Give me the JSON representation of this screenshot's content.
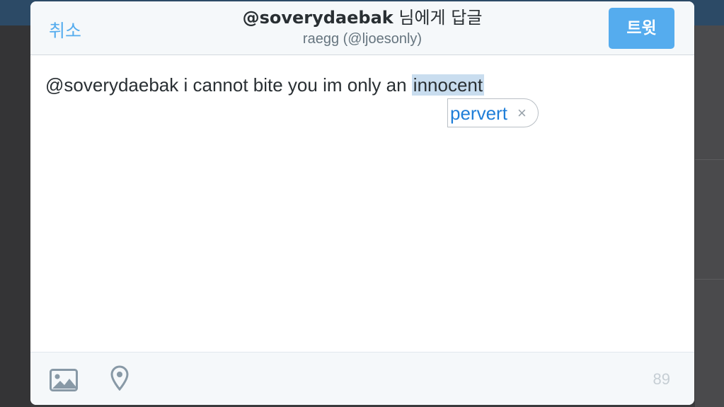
{
  "header": {
    "cancel_label": "취소",
    "title_handle": "@soverydaebak",
    "title_suffix": " 님에게 답글",
    "subtitle": "raegg (@ljoesonly)",
    "tweet_label": "트윗"
  },
  "compose": {
    "text_before": "@soverydaebak i cannot bite you im only an ",
    "highlighted_word": "innocent",
    "suggestion": "pervert",
    "suggestion_dismiss": "×"
  },
  "toolbar": {
    "photo_icon": "photo-icon",
    "location_icon": "location-pin-icon",
    "char_count": "89"
  },
  "colors": {
    "accent": "#55acee",
    "suggestion_text": "#1f7ed8",
    "highlight": "#c9ddef"
  }
}
